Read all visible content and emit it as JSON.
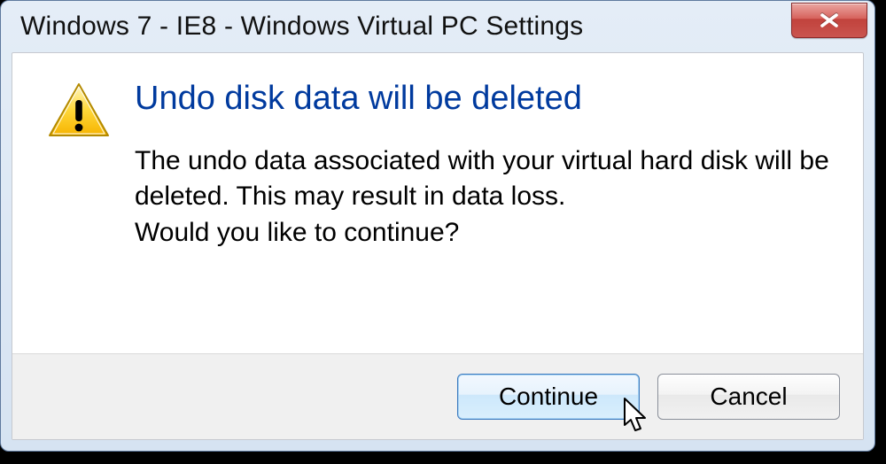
{
  "window": {
    "title": "Windows 7 - IE8 - Windows Virtual PC Settings"
  },
  "dialog": {
    "heading": "Undo disk data will be deleted",
    "body_line1": "The undo data associated with your virtual hard disk will be deleted. This may result in data loss.",
    "body_line2": "Would you like to continue?"
  },
  "buttons": {
    "continue": "Continue",
    "cancel": "Cancel"
  }
}
